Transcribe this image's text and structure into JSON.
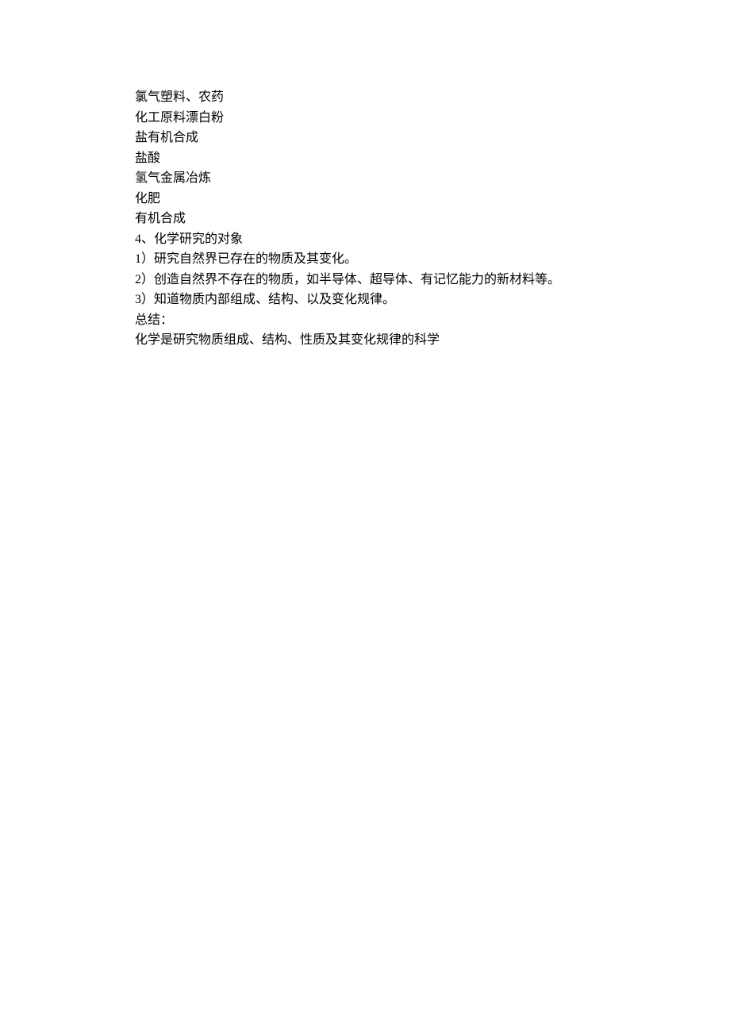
{
  "lines": [
    "氯气塑料、农药",
    "化工原料漂白粉",
    "盐有机合成",
    "盐酸",
    "氢气金属冶炼",
    "化肥",
    "有机合成",
    "4、化学研究的对象",
    "1）研究自然界已存在的物质及其变化。",
    "2）创造自然界不存在的物质，如半导体、超导体、有记忆能力的新材料等。",
    "3）知道物质内部组成、结构、以及变化规律。",
    "总结：",
    "化学是研究物质组成、结构、性质及其变化规律的科学"
  ]
}
